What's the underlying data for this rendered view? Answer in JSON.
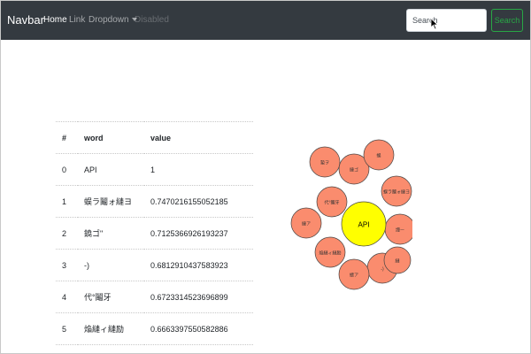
{
  "navbar": {
    "brand": "Navbar",
    "links": {
      "home": "Home",
      "link": "Link",
      "dropdown": "Dropdown",
      "disabled": "Disabled"
    },
    "search": {
      "placeholder": "Search",
      "button": "Search"
    },
    "background": "#343a40",
    "search_button_color": "#28a745"
  },
  "table": {
    "headers": {
      "index": "#",
      "word": "word",
      "value": "value"
    },
    "rows": [
      {
        "index": "0",
        "word": "API",
        "value": "1"
      },
      {
        "index": "1",
        "word": "蜈ラ鬮ォ縺ヨ",
        "value": "0.7470216155052185"
      },
      {
        "index": "2",
        "word": "鐃ゴ\"",
        "value": "0.7125366926193237"
      },
      {
        "index": "3",
        "word": "-)",
        "value": "0.6812910437583923"
      },
      {
        "index": "4",
        "word": "代°鬮牙",
        "value": "0.6723314523696899"
      },
      {
        "index": "5",
        "word": "焔縺ィ縺励",
        "value": "0.6663397550582886"
      }
    ]
  },
  "bubble_chart": {
    "center": {
      "label": "API",
      "color": "#ffff00"
    },
    "bubble_color": "#fa8c6e",
    "bubbles": [
      "蜈ラ鬮ォ縺ヨ",
      "鐃ゴ\"",
      "-)",
      "代°鬮牙",
      "焔縺ィ縺励",
      "縺ア",
      "譁ー",
      "蟄ヲ",
      "縺ゴ",
      "蜈",
      "繧ア",
      "縺"
    ]
  }
}
